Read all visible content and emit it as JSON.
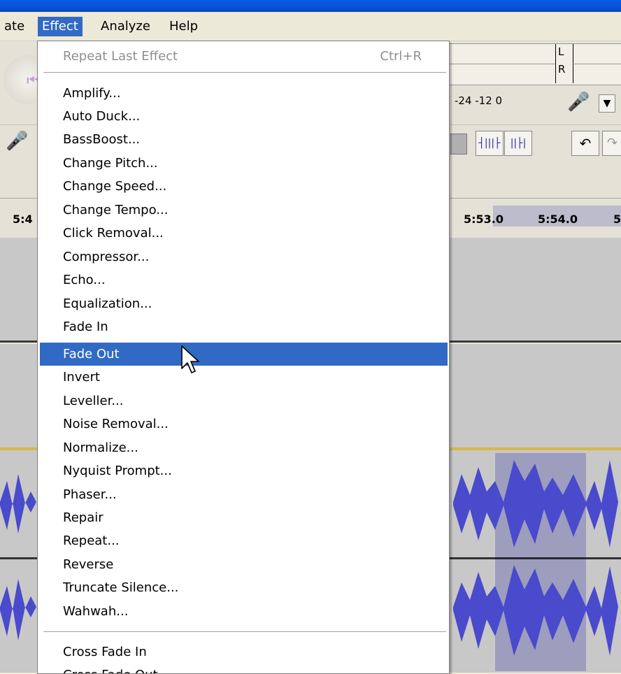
{
  "menubar": {
    "items": [
      {
        "label": "ate"
      },
      {
        "label": "Effect"
      },
      {
        "label": "Analyze"
      },
      {
        "label": "Help"
      }
    ]
  },
  "meter": {
    "left_label": "L",
    "right_label": "R",
    "scale": "-24 -12  0"
  },
  "timeline": {
    "left_tick": "5:4",
    "ticks": [
      "5:53.0",
      "5:54.0",
      "5"
    ]
  },
  "effect_menu": {
    "repeat_last": {
      "label": "Repeat Last Effect",
      "shortcut": "Ctrl+R"
    },
    "items": [
      "Amplify...",
      "Auto Duck...",
      "BassBoost...",
      "Change Pitch...",
      "Change Speed...",
      "Change Tempo...",
      "Click Removal...",
      "Compressor...",
      "Echo...",
      "Equalization...",
      "Fade In",
      "Fade Out",
      "Invert",
      "Leveller...",
      "Noise Removal...",
      "Normalize...",
      "Nyquist Prompt...",
      "Phaser...",
      "Repair",
      "Repeat...",
      "Reverse",
      "Truncate Silence...",
      "Wahwah..."
    ],
    "highlighted": "Fade Out",
    "tail_items": [
      "Cross Fade In",
      "Cross Fade Out"
    ]
  }
}
